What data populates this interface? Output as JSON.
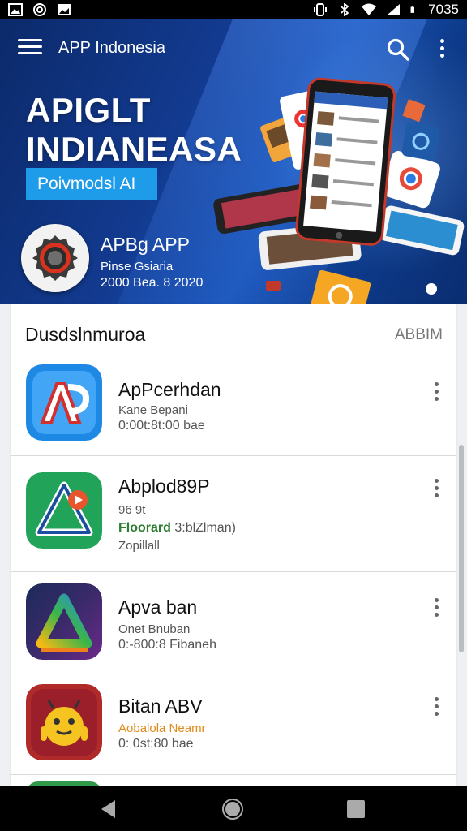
{
  "status_bar": {
    "time": "7035"
  },
  "app_bar": {
    "title": "APP Indonesia"
  },
  "hero": {
    "headline_line1": "APIGLT",
    "headline_line2": "INDIANEASA",
    "button_label": "Poivmodsl AI",
    "featured_name": "APBg APP",
    "featured_subtitle": "Pinse Gsiaria",
    "featured_date": "2000 Bea. 8 2020"
  },
  "section": {
    "title": "Dusdslnmuroa",
    "action": "ABBIM"
  },
  "apps": [
    {
      "name": "ApPcerhdan",
      "line1": "Kane Bepani",
      "line2": "0:00t:8t:00 bae",
      "line3": "",
      "icon": "app-logo-blue"
    },
    {
      "name": "Abplod89P",
      "line1": "96 9t",
      "line2_strong": "Floorard",
      "line2": "3:blZlman)",
      "line3": "Zopillall",
      "icon": "app-logo-green"
    },
    {
      "name": "Apva ban",
      "line1": "Onet Bnuban",
      "line2": "0:-800:8 Fibaneh",
      "line3": "",
      "icon": "app-logo-gradient"
    },
    {
      "name": "Bitan ABV",
      "line1": "Aobalola Neamr",
      "line2": "0: 0st:80 bae",
      "line3": "",
      "icon": "app-logo-robot"
    }
  ],
  "colors": {
    "accent": "#1e9be9",
    "hero_bg": "#123a8f",
    "statusbar": "#000000",
    "green_text": "#2e7d32",
    "orange_text": "#e08a1a"
  },
  "icons": [
    "image-icon",
    "notification-icon",
    "gallery-icon",
    "vibrate-icon",
    "bluetooth-icon",
    "wifi-icon",
    "signal-icon",
    "battery-icon",
    "menu-icon",
    "search-icon",
    "more-vert-icon",
    "back-icon",
    "home-icon",
    "recents-icon"
  ]
}
